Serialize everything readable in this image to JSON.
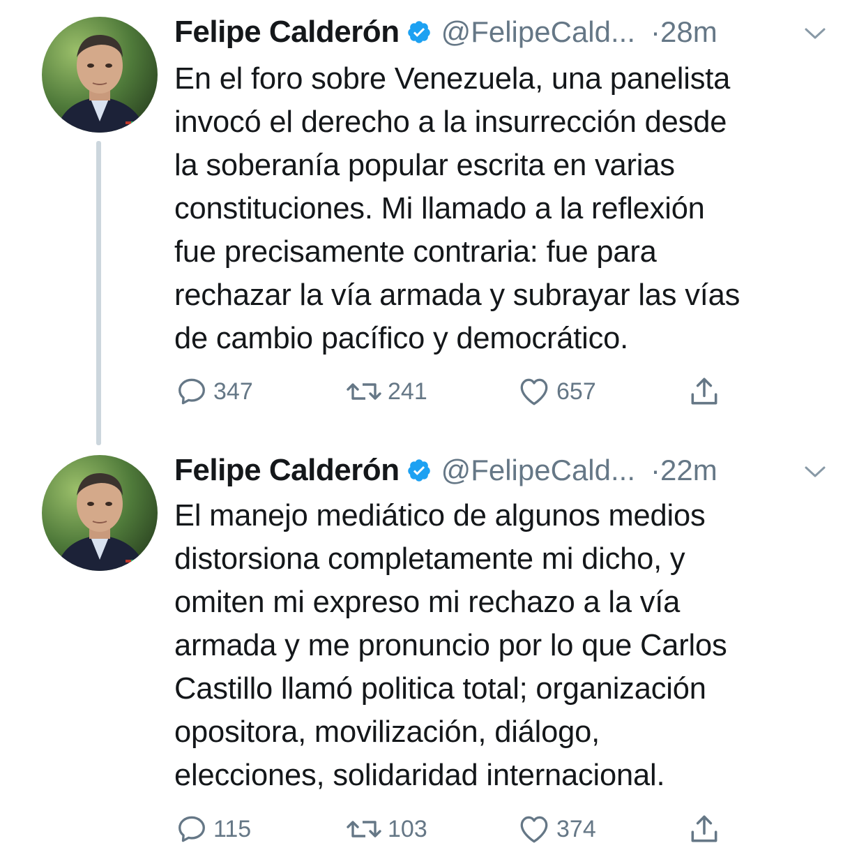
{
  "tweets": [
    {
      "author_name": "Felipe Calderón",
      "handle": "@FelipeCald...",
      "time": "·28m",
      "lines": [
        "En el foro sobre Venezuela, una panelista",
        "invocó el derecho a la insurrección desde",
        "la soberanía popular escrita en varias",
        "constituciones. Mi llamado a la reflexión",
        "fue precisamente contraria: fue para",
        "rechazar la vía armada y subrayar las vías",
        "de cambio pacífico y democrático."
      ],
      "replies": "347",
      "retweets": "241",
      "likes": "657"
    },
    {
      "author_name": "Felipe Calderón",
      "handle": "@FelipeCald...",
      "time": "·22m",
      "lines": [
        "El manejo mediático de algunos medios",
        "distorsiona completamente mi dicho, y",
        "omiten mi expreso mi rechazo a la vía",
        "armada y me pronuncio por lo que Carlos",
        "Castillo llamó politica total; organización",
        "opositora, movilización, diálogo,",
        "elecciones, solidaridad internacional."
      ],
      "replies": "115",
      "retweets": "103",
      "likes": "374"
    }
  ],
  "colors": {
    "text": "#14171a",
    "secondary": "#657786",
    "verified": "#1da1f2",
    "thread_line": "#ccd6dd"
  },
  "icons": {
    "verified": "verified-badge-icon",
    "caret": "chevron-down-icon",
    "reply": "reply-icon",
    "retweet": "retweet-icon",
    "like": "heart-icon",
    "share": "share-icon"
  }
}
